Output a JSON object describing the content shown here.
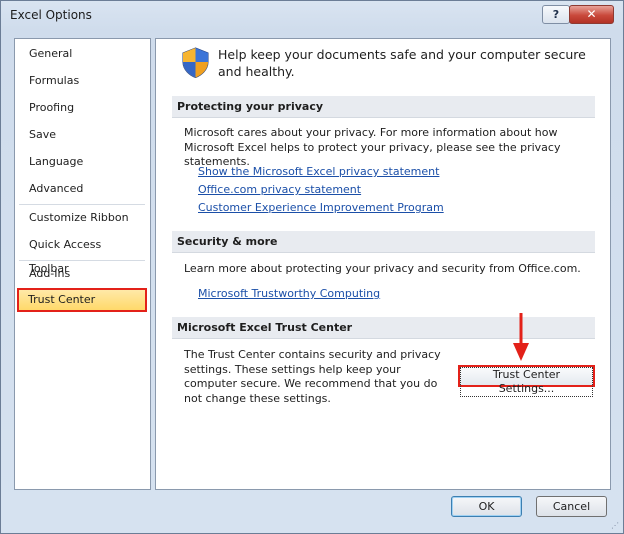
{
  "window": {
    "title": "Excel Options",
    "help_glyph": "?",
    "close_glyph": "✕"
  },
  "nav": {
    "items": [
      {
        "label": "General"
      },
      {
        "label": "Formulas"
      },
      {
        "label": "Proofing"
      },
      {
        "label": "Save"
      },
      {
        "label": "Language"
      },
      {
        "label": "Advanced"
      },
      {
        "label": "Customize Ribbon"
      },
      {
        "label": "Quick Access Toolbar"
      },
      {
        "label": "Add-Ins"
      },
      {
        "label": "Trust Center",
        "selected": true
      }
    ]
  },
  "main": {
    "intro": "Help keep your documents safe and your computer secure and healthy.",
    "privacy": {
      "header": "Protecting your privacy",
      "text": "Microsoft cares about your privacy. For more information about how Microsoft Excel helps to protect your privacy, please see the privacy statements.",
      "links": [
        "Show the Microsoft Excel privacy statement",
        "Office.com privacy statement",
        "Customer Experience Improvement Program"
      ]
    },
    "security": {
      "header": "Security & more",
      "text": "Learn more about protecting your privacy and security from Office.com.",
      "link": "Microsoft Trustworthy Computing"
    },
    "trust_center": {
      "header": "Microsoft Excel Trust Center",
      "text": "The Trust Center contains security and privacy settings. These settings help keep your computer secure. We recommend that you do not change these settings.",
      "button_label": "Trust Center Settings..."
    }
  },
  "footer": {
    "ok_label": "OK",
    "cancel_label": "Cancel"
  },
  "colors": {
    "highlight_border": "#e32119",
    "selected_fill": "#ffd96a",
    "link": "#1b4fa8"
  },
  "icons": [
    "shield-icon",
    "help-icon",
    "close-icon",
    "red-arrow-annotation",
    "resize-grip-icon"
  ]
}
